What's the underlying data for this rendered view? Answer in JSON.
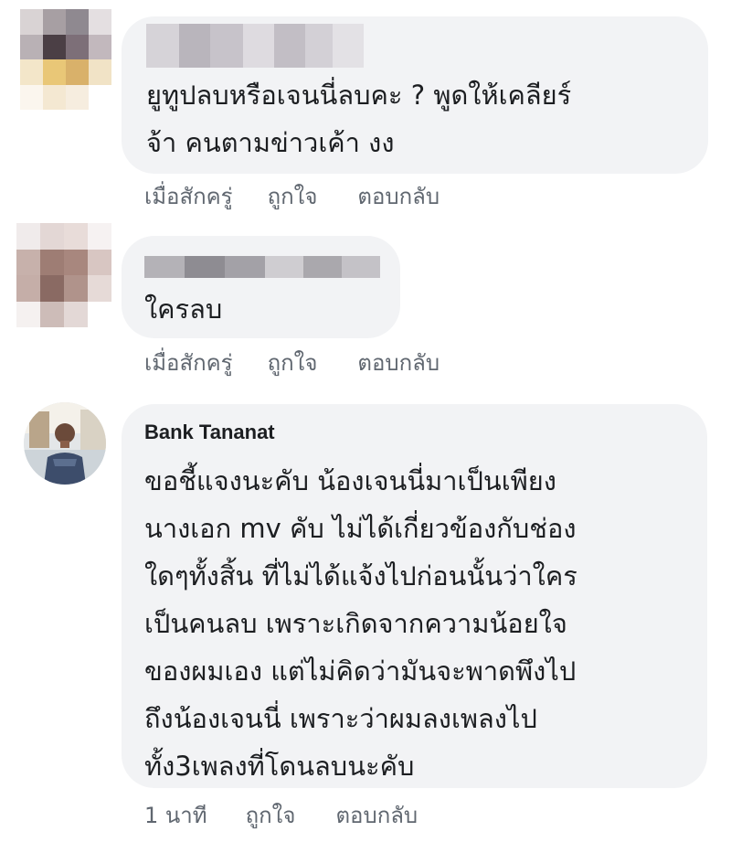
{
  "comments": [
    {
      "author": "",
      "text": "ยูทูปลบหรือเจนนี่ลบคะ ? พูดให้เคลียร์\nจ้า คนตามข่าวเค้า งง",
      "time": "เมื่อสักครู่",
      "like_label": "ถูกใจ",
      "reply_label": "ตอบกลับ"
    },
    {
      "author": "",
      "text": "ใครลบ",
      "time": "เมื่อสักครู่",
      "like_label": "ถูกใจ",
      "reply_label": "ตอบกลับ"
    },
    {
      "author": "Bank Tananat",
      "text": "ขอชี้แจงนะคับ น้องเจนนี่มาเป็นเพียง\nนางเอก mv คับ ไม่ได้เกี่ยวข้องกับช่อง\nใดๆทั้งสิ้น ที่ไม่ได้แจ้งไปก่อนนั้นว่าใคร\nเป็นคนลบ เพราะเกิดจากความน้อยใจ\nของผมเอง แต่ไม่คิดว่ามันจะพาดพึงไป\nถึงน้องเจนนี่ เพราะว่าผมลงเพลงไป\nทั้ง3เพลงที่โดนลบนะคับ",
      "time": "1 นาที",
      "like_label": "ถูกใจ",
      "reply_label": "ตอบกลับ"
    }
  ],
  "colors": {
    "bubble": "#f2f3f5",
    "text": "#1c1e21",
    "meta": "#606770"
  }
}
